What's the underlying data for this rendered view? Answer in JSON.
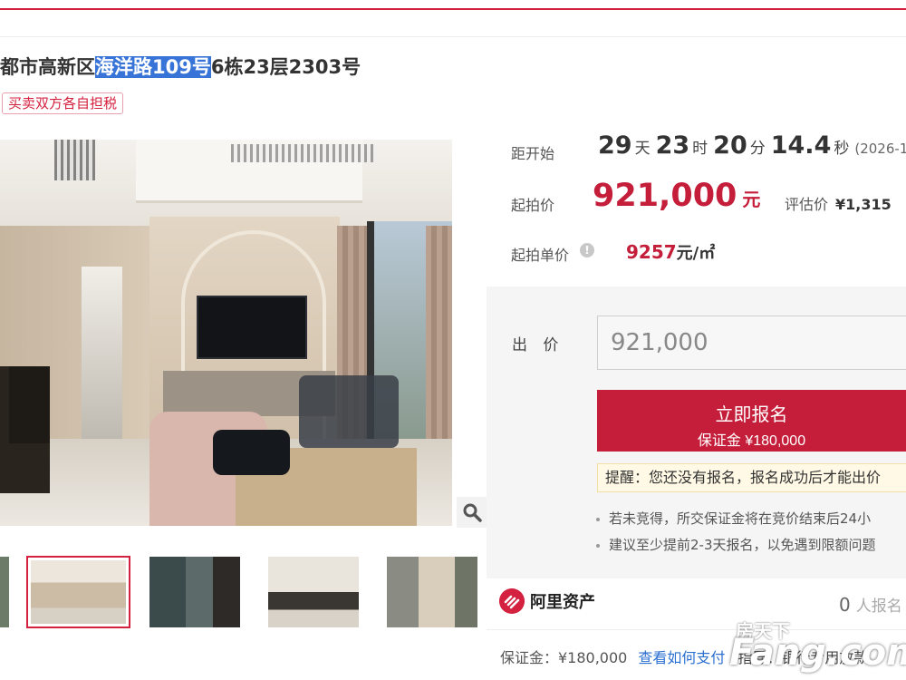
{
  "header": {
    "title_pre": "都市高新区",
    "title_highlight": "海洋路109号",
    "title_post": "6栋23层2303号",
    "tax_tag": "买卖双方各自担税"
  },
  "auction": {
    "countdown_label": "距开始",
    "days": "29",
    "days_unit": "天",
    "hours": "23",
    "hours_unit": "时",
    "minutes": "20",
    "minutes_unit": "分",
    "seconds": "14.4",
    "seconds_unit": "秒",
    "start_date": "(2026-1",
    "start_price_label": "起拍价",
    "start_price": "921,000",
    "start_price_unit": "元",
    "eval_label": "评估价",
    "eval_value": "¥1,315",
    "unit_price_label": "起拍单价",
    "unit_price": "9257",
    "unit_price_unit": "元/㎡"
  },
  "bid": {
    "label": "出 价",
    "value": "921,000",
    "signup_label": "立即报名",
    "deposit_label": "保证金 ¥180,000",
    "reminder": "提醒：您还没有报名，报名成功后才能出价",
    "tips": [
      "若未竞得，所交保证金将在竞价结束后24小",
      "建议至少提前2-3天报名，以免遇到限额问题"
    ]
  },
  "footer": {
    "brand_name": "阿里资产",
    "signup_count": "0",
    "signup_suffix": "人报名",
    "deposit_text": "保证金：¥180,000",
    "how_to_pay": "查看如何支付",
    "extra": "指导：银行专用放款"
  },
  "watermark": {
    "zh": "房天下",
    "en": "Fang.com"
  },
  "colors": {
    "accent": "#c51e3a",
    "link": "#2b6fd0"
  }
}
